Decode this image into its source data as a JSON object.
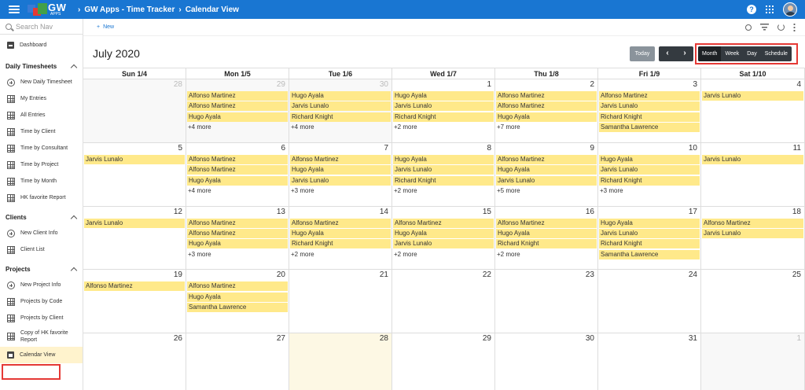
{
  "header": {
    "logo_text": "GW",
    "logo_sub": "APPS",
    "breadcrumb": [
      "GW Apps - Time Tracker",
      "Calendar View"
    ],
    "help_label": "?"
  },
  "sidebar": {
    "search_placeholder": "Search Nav",
    "dashboard": "Dashboard",
    "sections": [
      {
        "title": "Daily Timesheets",
        "items": [
          "New Daily Timesheet",
          "My Entries",
          "All Entries",
          "Time by Client",
          "Time by Consultant",
          "Time by Project",
          "Time by Month",
          "HK favorite Report"
        ]
      },
      {
        "title": "Clients",
        "items": [
          "New Client Info",
          "Client List"
        ]
      },
      {
        "title": "Projects",
        "items": [
          "New Project Info",
          "Projects by Code",
          "Projects by Client",
          "Copy of HK favorite Report",
          "Calendar View"
        ]
      }
    ]
  },
  "toolbar": {
    "new_label": "New"
  },
  "calendar": {
    "month_title": "July 2020",
    "today_label": "Today",
    "prev_label": "‹",
    "next_label": "›",
    "views": [
      "Month",
      "Week",
      "Day",
      "Schedule"
    ],
    "active_view": "Month",
    "days_of_week": [
      "Sun 1/4",
      "Mon 1/5",
      "Tue 1/6",
      "Wed 1/7",
      "Thu 1/8",
      "Fri 1/9",
      "Sat 1/10"
    ],
    "weeks": [
      [
        {
          "num": "28",
          "other": true,
          "events": [],
          "more": ""
        },
        {
          "num": "29",
          "other": true,
          "events": [
            "Alfonso Martinez",
            "Alfonso Martinez",
            "Hugo Ayala"
          ],
          "more": "+4 more"
        },
        {
          "num": "30",
          "other": true,
          "events": [
            "Hugo Ayala",
            "Jarvis Lunalo",
            "Richard Knight"
          ],
          "more": "+4 more"
        },
        {
          "num": "1",
          "events": [
            "Hugo Ayala",
            "Jarvis Lunalo",
            "Richard Knight"
          ],
          "more": "+2 more"
        },
        {
          "num": "2",
          "events": [
            "Alfonso Martinez",
            "Alfonso Martinez",
            "Hugo Ayala"
          ],
          "more": "+7 more"
        },
        {
          "num": "3",
          "events": [
            "Alfonso Martinez",
            "Jarvis Lunalo",
            "Richard Knight",
            "Samantha Lawrence"
          ],
          "more": ""
        },
        {
          "num": "4",
          "events": [
            "Jarvis Lunalo"
          ],
          "more": ""
        }
      ],
      [
        {
          "num": "5",
          "events": [
            "Jarvis Lunalo"
          ],
          "more": ""
        },
        {
          "num": "6",
          "events": [
            "Alfonso Martinez",
            "Alfonso Martinez",
            "Hugo Ayala"
          ],
          "more": "+4 more"
        },
        {
          "num": "7",
          "events": [
            "Alfonso Martinez",
            "Hugo Ayala",
            "Jarvis Lunalo"
          ],
          "more": "+3 more"
        },
        {
          "num": "8",
          "events": [
            "Hugo Ayala",
            "Jarvis Lunalo",
            "Richard Knight"
          ],
          "more": "+2 more"
        },
        {
          "num": "9",
          "events": [
            "Alfonso Martinez",
            "Hugo Ayala",
            "Jarvis Lunalo"
          ],
          "more": "+5 more"
        },
        {
          "num": "10",
          "events": [
            "Hugo Ayala",
            "Jarvis Lunalo",
            "Richard Knight"
          ],
          "more": "+3 more"
        },
        {
          "num": "11",
          "events": [
            "Jarvis Lunalo"
          ],
          "more": ""
        }
      ],
      [
        {
          "num": "12",
          "events": [
            "Jarvis Lunalo"
          ],
          "more": ""
        },
        {
          "num": "13",
          "events": [
            "Alfonso Martinez",
            "Alfonso Martinez",
            "Hugo Ayala"
          ],
          "more": "+3 more"
        },
        {
          "num": "14",
          "events": [
            "Alfonso Martinez",
            "Hugo Ayala",
            "Richard Knight"
          ],
          "more": "+2 more"
        },
        {
          "num": "15",
          "events": [
            "Alfonso Martinez",
            "Hugo Ayala",
            "Jarvis Lunalo"
          ],
          "more": "+2 more"
        },
        {
          "num": "16",
          "events": [
            "Alfonso Martinez",
            "Hugo Ayala",
            "Richard Knight"
          ],
          "more": "+2 more"
        },
        {
          "num": "17",
          "events": [
            "Hugo Ayala",
            "Jarvis Lunalo",
            "Richard Knight",
            "Samantha Lawrence"
          ],
          "more": ""
        },
        {
          "num": "18",
          "events": [
            "Alfonso Martinez",
            "Jarvis Lunalo"
          ],
          "more": ""
        }
      ],
      [
        {
          "num": "19",
          "events": [
            "Alfonso Martinez"
          ],
          "more": ""
        },
        {
          "num": "20",
          "events": [
            "Alfonso Martinez",
            "Hugo Ayala",
            "Samantha Lawrence"
          ],
          "more": ""
        },
        {
          "num": "21",
          "events": [],
          "more": ""
        },
        {
          "num": "22",
          "events": [],
          "more": ""
        },
        {
          "num": "23",
          "events": [],
          "more": ""
        },
        {
          "num": "24",
          "events": [],
          "more": ""
        },
        {
          "num": "25",
          "events": [],
          "more": ""
        }
      ],
      [
        {
          "num": "26",
          "events": [],
          "more": ""
        },
        {
          "num": "27",
          "events": [],
          "more": ""
        },
        {
          "num": "28",
          "today": true,
          "events": [],
          "more": ""
        },
        {
          "num": "29",
          "events": [],
          "more": ""
        },
        {
          "num": "30",
          "events": [],
          "more": ""
        },
        {
          "num": "31",
          "events": [],
          "more": ""
        },
        {
          "num": "1",
          "other": true,
          "events": [],
          "more": ""
        }
      ]
    ]
  },
  "colors": {
    "topbar": "#1976d2",
    "event": "#ffe98a",
    "highlight": "#e53935",
    "active_nav": "#fff3cd"
  }
}
